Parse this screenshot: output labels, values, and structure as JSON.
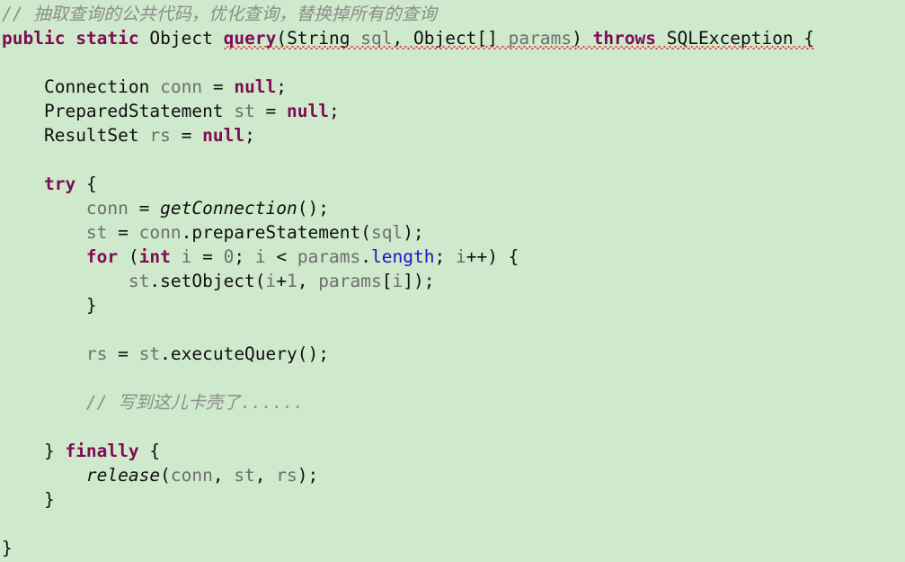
{
  "editor": {
    "language": "java",
    "background_color": "#cee9cb",
    "keyword_color": "#7f0b55",
    "identifier_color": "#6e6e6e",
    "comment_color": "#8a8f8a",
    "field_color": "#1414c8",
    "error_underline_color": "#e03b3b",
    "font_size_px": 19.5,
    "line_height_px": 27
  },
  "lines": [
    {
      "n": 1,
      "indent": 0,
      "tokens": [
        {
          "t": "// 抽取查询的公共代码，优化查询，替换掉所有的查询",
          "c": "comment"
        }
      ]
    },
    {
      "n": 2,
      "indent": 0,
      "underline": true,
      "tokens": [
        {
          "t": "public",
          "c": "kw"
        },
        {
          "t": " ",
          "c": "plain"
        },
        {
          "t": "static",
          "c": "kw"
        },
        {
          "t": " ",
          "c": "plain"
        },
        {
          "t": "Object",
          "c": "plain"
        },
        {
          "t": " ",
          "c": "plain"
        },
        {
          "t": "query",
          "c": "kw"
        },
        {
          "t": "(",
          "c": "punct"
        },
        {
          "t": "String",
          "c": "plain"
        },
        {
          "t": " ",
          "c": "plain"
        },
        {
          "t": "sql",
          "c": "ident"
        },
        {
          "t": ", ",
          "c": "punct"
        },
        {
          "t": "Object[]",
          "c": "plain"
        },
        {
          "t": " ",
          "c": "plain"
        },
        {
          "t": "params",
          "c": "ident"
        },
        {
          "t": ") ",
          "c": "punct"
        },
        {
          "t": "throws",
          "c": "kw"
        },
        {
          "t": " ",
          "c": "plain"
        },
        {
          "t": "SQLException",
          "c": "plain"
        },
        {
          "t": " {",
          "c": "punct"
        }
      ]
    },
    {
      "n": 3,
      "indent": 0,
      "tokens": []
    },
    {
      "n": 4,
      "indent": 4,
      "tokens": [
        {
          "t": "Connection",
          "c": "plain"
        },
        {
          "t": " ",
          "c": "plain"
        },
        {
          "t": "conn",
          "c": "ident"
        },
        {
          "t": " = ",
          "c": "punct"
        },
        {
          "t": "null",
          "c": "kw"
        },
        {
          "t": ";",
          "c": "punct"
        }
      ]
    },
    {
      "n": 5,
      "indent": 4,
      "tokens": [
        {
          "t": "PreparedStatement",
          "c": "plain"
        },
        {
          "t": " ",
          "c": "plain"
        },
        {
          "t": "st",
          "c": "ident"
        },
        {
          "t": " = ",
          "c": "punct"
        },
        {
          "t": "null",
          "c": "kw"
        },
        {
          "t": ";",
          "c": "punct"
        }
      ]
    },
    {
      "n": 6,
      "indent": 4,
      "tokens": [
        {
          "t": "ResultSet",
          "c": "plain"
        },
        {
          "t": " ",
          "c": "plain"
        },
        {
          "t": "rs",
          "c": "ident"
        },
        {
          "t": " = ",
          "c": "punct"
        },
        {
          "t": "null",
          "c": "kw"
        },
        {
          "t": ";",
          "c": "punct"
        }
      ]
    },
    {
      "n": 7,
      "indent": 0,
      "tokens": []
    },
    {
      "n": 8,
      "indent": 4,
      "tokens": [
        {
          "t": "try",
          "c": "kw"
        },
        {
          "t": " {",
          "c": "punct"
        }
      ]
    },
    {
      "n": 9,
      "indent": 8,
      "tokens": [
        {
          "t": "conn",
          "c": "ident"
        },
        {
          "t": " = ",
          "c": "punct"
        },
        {
          "t": "getConnection",
          "c": "method"
        },
        {
          "t": "();",
          "c": "punct"
        }
      ]
    },
    {
      "n": 10,
      "indent": 8,
      "tokens": [
        {
          "t": "st",
          "c": "ident"
        },
        {
          "t": " = ",
          "c": "punct"
        },
        {
          "t": "conn",
          "c": "ident"
        },
        {
          "t": ".",
          "c": "punct"
        },
        {
          "t": "prepareStatement",
          "c": "plain"
        },
        {
          "t": "(",
          "c": "punct"
        },
        {
          "t": "sql",
          "c": "ident"
        },
        {
          "t": ");",
          "c": "punct"
        }
      ]
    },
    {
      "n": 11,
      "indent": 8,
      "tokens": [
        {
          "t": "for",
          "c": "kw"
        },
        {
          "t": " (",
          "c": "punct"
        },
        {
          "t": "int",
          "c": "kw"
        },
        {
          "t": " ",
          "c": "plain"
        },
        {
          "t": "i",
          "c": "ident"
        },
        {
          "t": " = ",
          "c": "punct"
        },
        {
          "t": "0",
          "c": "num"
        },
        {
          "t": "; ",
          "c": "punct"
        },
        {
          "t": "i",
          "c": "ident"
        },
        {
          "t": " < ",
          "c": "punct"
        },
        {
          "t": "params",
          "c": "ident"
        },
        {
          "t": ".",
          "c": "punct"
        },
        {
          "t": "length",
          "c": "field"
        },
        {
          "t": "; ",
          "c": "punct"
        },
        {
          "t": "i",
          "c": "ident"
        },
        {
          "t": "++) {",
          "c": "punct"
        }
      ]
    },
    {
      "n": 12,
      "indent": 12,
      "tokens": [
        {
          "t": "st",
          "c": "ident"
        },
        {
          "t": ".",
          "c": "punct"
        },
        {
          "t": "setObject",
          "c": "plain"
        },
        {
          "t": "(",
          "c": "punct"
        },
        {
          "t": "i",
          "c": "ident"
        },
        {
          "t": "+",
          "c": "punct"
        },
        {
          "t": "1",
          "c": "num"
        },
        {
          "t": ", ",
          "c": "punct"
        },
        {
          "t": "params",
          "c": "ident"
        },
        {
          "t": "[",
          "c": "punct"
        },
        {
          "t": "i",
          "c": "ident"
        },
        {
          "t": "]);",
          "c": "punct"
        }
      ]
    },
    {
      "n": 13,
      "indent": 8,
      "tokens": [
        {
          "t": "}",
          "c": "punct"
        }
      ]
    },
    {
      "n": 14,
      "indent": 0,
      "tokens": []
    },
    {
      "n": 15,
      "indent": 8,
      "tokens": [
        {
          "t": "rs",
          "c": "ident"
        },
        {
          "t": " = ",
          "c": "punct"
        },
        {
          "t": "st",
          "c": "ident"
        },
        {
          "t": ".",
          "c": "punct"
        },
        {
          "t": "executeQuery",
          "c": "plain"
        },
        {
          "t": "();",
          "c": "punct"
        }
      ]
    },
    {
      "n": 16,
      "indent": 0,
      "tokens": []
    },
    {
      "n": 17,
      "indent": 8,
      "tokens": [
        {
          "t": "// 写到这儿卡壳了......",
          "c": "comment"
        }
      ]
    },
    {
      "n": 18,
      "indent": 0,
      "tokens": []
    },
    {
      "n": 19,
      "indent": 4,
      "tokens": [
        {
          "t": "} ",
          "c": "punct"
        },
        {
          "t": "finally",
          "c": "kw"
        },
        {
          "t": " {",
          "c": "punct"
        }
      ]
    },
    {
      "n": 20,
      "indent": 8,
      "tokens": [
        {
          "t": "release",
          "c": "method"
        },
        {
          "t": "(",
          "c": "punct"
        },
        {
          "t": "conn",
          "c": "ident"
        },
        {
          "t": ", ",
          "c": "punct"
        },
        {
          "t": "st",
          "c": "ident"
        },
        {
          "t": ", ",
          "c": "punct"
        },
        {
          "t": "rs",
          "c": "ident"
        },
        {
          "t": ");",
          "c": "punct"
        }
      ]
    },
    {
      "n": 21,
      "indent": 4,
      "tokens": [
        {
          "t": "}",
          "c": "punct"
        }
      ]
    },
    {
      "n": 22,
      "indent": 0,
      "tokens": []
    },
    {
      "n": 23,
      "indent": 0,
      "tokens": [
        {
          "t": "}",
          "c": "punct"
        }
      ]
    }
  ]
}
